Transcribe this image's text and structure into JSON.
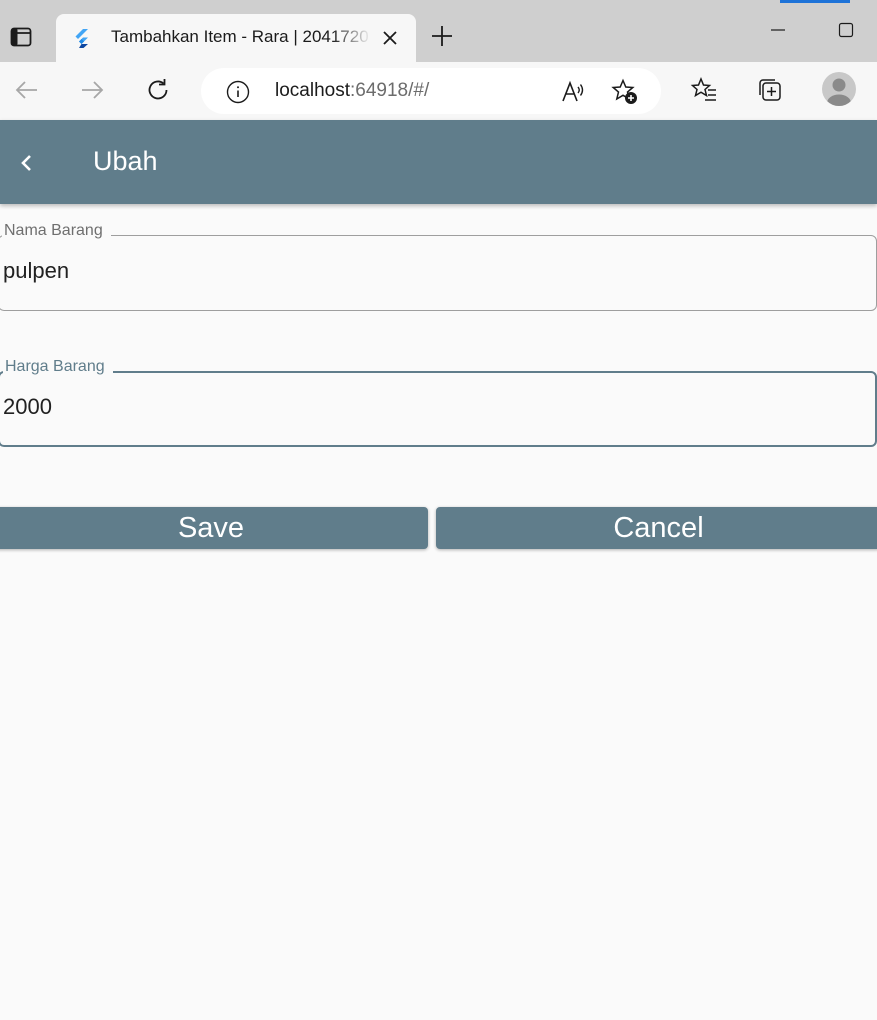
{
  "browser": {
    "tab": {
      "title": "Tambahkan Item - Rara | 2041720",
      "favicon": "flutter-icon"
    },
    "url": {
      "host": "localhost",
      "path": ":64918/#/"
    },
    "icons": {
      "tab_actions": "tab-actions-icon",
      "close": "close-icon",
      "new_tab": "plus-icon",
      "back": "arrow-left-icon",
      "forward": "arrow-right-icon",
      "reload": "reload-icon",
      "info": "info-icon",
      "read_aloud": "read-aloud-icon",
      "add_favorite": "star-plus-icon",
      "favorites": "favorites-list-icon",
      "collections": "collections-icon",
      "profile": "profile-avatar"
    },
    "colors": {
      "chrome": "#cfcfcf",
      "toolbar": "#f7f7f7",
      "accent": "#1e73d8"
    }
  },
  "app": {
    "appbar": {
      "title": "Ubah",
      "back_icon": "chevron-left-icon"
    },
    "form": {
      "fields": [
        {
          "label": "Nama Barang",
          "value": "pulpen",
          "focused": false
        },
        {
          "label": "Harga Barang",
          "value": "2000",
          "focused": true
        }
      ],
      "buttons": {
        "save": "Save",
        "cancel": "Cancel"
      }
    },
    "colors": {
      "primary": "#607d8b",
      "background": "#fafafa",
      "on_primary": "#ffffff"
    }
  }
}
